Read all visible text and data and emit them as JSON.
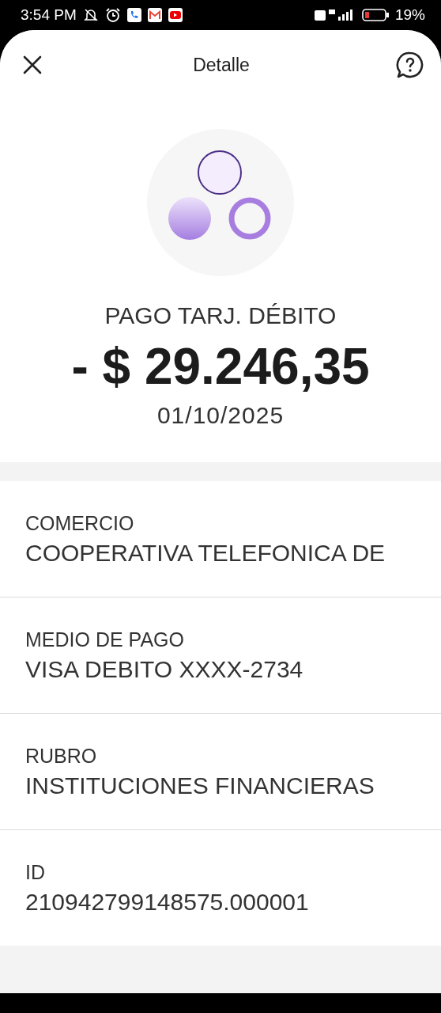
{
  "status_bar": {
    "time": "3:54 PM",
    "battery_level": "19%"
  },
  "header": {
    "title": "Detalle"
  },
  "summary": {
    "kind": "picture",
    "description": "PAGO TARJ. DÉBITO",
    "amount": "- $ 29.246,35",
    "date": "01/10/2025"
  },
  "details": [
    {
      "label": "COMERCIO",
      "value": "COOPERATIVA TELEFONICA DE"
    },
    {
      "label": "MEDIO DE PAGO",
      "value": "VISA DEBITO XXXX-2734"
    },
    {
      "label": "RUBRO",
      "value": "INSTITUCIONES FINANCIERAS"
    },
    {
      "label": "ID",
      "value": "210942799148575.000001"
    }
  ]
}
